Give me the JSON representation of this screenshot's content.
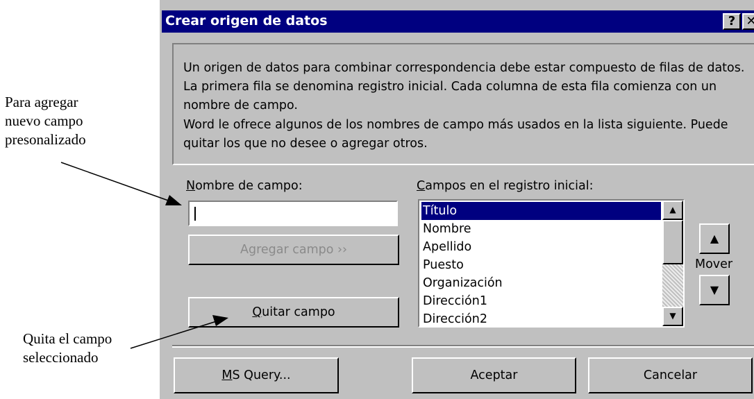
{
  "annotations": {
    "add_field_note": [
      "Para agregar",
      "nuevo campo",
      "presonalizado"
    ],
    "remove_field_note": [
      "Quita el campo",
      "seleccionado"
    ]
  },
  "dialog": {
    "title": "Crear origen de datos",
    "help_glyph": "?",
    "close_glyph": "✕",
    "description_p1": "Un origen de datos para combinar correspondencia debe estar compuesto de filas de datos. La primera fila se denomina registro inicial. Cada columna de esta fila comienza con un nombre de campo.",
    "description_p2": "Word le ofrece algunos de los nombres de campo más usados en la lista siguiente. Puede quitar los que no desee o agregar otros.",
    "field_name_label_key": "N",
    "field_name_label_rest": "ombre de campo:",
    "field_name_value": "",
    "add_field_button": "Agregar campo  ››",
    "remove_field_key": "Q",
    "remove_field_rest": "uitar campo",
    "fields_label_key": "C",
    "fields_label_rest": "ampos en el registro inicial:",
    "fields": [
      "Título",
      "Nombre",
      "Apellido",
      "Puesto",
      "Organización",
      "Dirección1",
      "Dirección2"
    ],
    "selected_field": "Título",
    "move_label": "Mover",
    "move_up_glyph": "▲",
    "move_down_glyph": "▼",
    "ms_query_key": "M",
    "ms_query_rest": "S Query...",
    "ok_button": "Aceptar",
    "cancel_button": "Cancelar"
  },
  "colors": {
    "titlebar": "#000080",
    "dialog_face": "#c0c0c0",
    "selection": "#000080"
  },
  "icons": {
    "help": "question-mark-icon",
    "close": "close-icon",
    "scroll_up": "scroll-up-arrow-icon",
    "scroll_down": "scroll-down-arrow-icon",
    "move_up": "move-up-arrow-icon",
    "move_down": "move-down-arrow-icon"
  }
}
